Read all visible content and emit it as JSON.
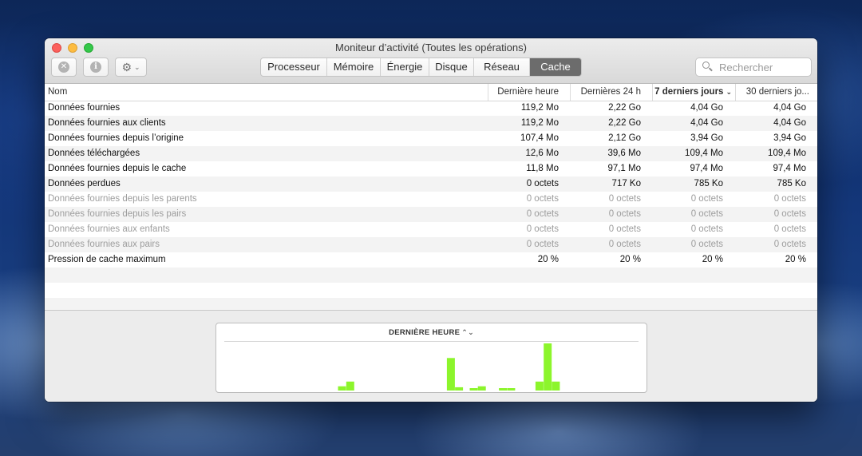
{
  "window": {
    "title": "Moniteur d’activité (Toutes les opérations)"
  },
  "toolbar": {
    "stop_icon": "x-circle-icon",
    "info_icon": "info-circle-icon",
    "gear_icon": "gear-icon"
  },
  "tabs": [
    {
      "label": "Processeur",
      "active": false
    },
    {
      "label": "Mémoire",
      "active": false
    },
    {
      "label": "Énergie",
      "active": false
    },
    {
      "label": "Disque",
      "active": false
    },
    {
      "label": "Réseau",
      "active": false
    },
    {
      "label": "Cache",
      "active": true
    }
  ],
  "search": {
    "placeholder": "Rechercher"
  },
  "table": {
    "columns": [
      "Nom",
      "Dernière heure",
      "Dernières 24 h",
      "7 derniers jours",
      "30 derniers jo..."
    ],
    "sorted_column": "7 derniers jours",
    "rows": [
      {
        "name": "Données fournies",
        "hour": "119,2 Mo",
        "day": "2,22 Go",
        "week": "4,04 Go",
        "month": "4,04 Go",
        "dim": false
      },
      {
        "name": "Données fournies aux clients",
        "hour": "119,2 Mo",
        "day": "2,22 Go",
        "week": "4,04 Go",
        "month": "4,04 Go",
        "dim": false
      },
      {
        "name": "Données fournies depuis l’origine",
        "hour": "107,4 Mo",
        "day": "2,12 Go",
        "week": "3,94 Go",
        "month": "3,94 Go",
        "dim": false
      },
      {
        "name": "Données téléchargées",
        "hour": "12,6 Mo",
        "day": "39,6 Mo",
        "week": "109,4 Mo",
        "month": "109,4 Mo",
        "dim": false
      },
      {
        "name": "Données fournies depuis le cache",
        "hour": "11,8 Mo",
        "day": "97,1 Mo",
        "week": "97,4 Mo",
        "month": "97,4 Mo",
        "dim": false
      },
      {
        "name": "Données perdues",
        "hour": "0 octets",
        "day": "717 Ko",
        "week": "785 Ko",
        "month": "785 Ko",
        "dim": false
      },
      {
        "name": "Données fournies depuis les parents",
        "hour": "0 octets",
        "day": "0 octets",
        "week": "0 octets",
        "month": "0 octets",
        "dim": true
      },
      {
        "name": "Données fournies depuis les pairs",
        "hour": "0 octets",
        "day": "0 octets",
        "week": "0 octets",
        "month": "0 octets",
        "dim": true
      },
      {
        "name": "Données fournies aux enfants",
        "hour": "0 octets",
        "day": "0 octets",
        "week": "0 octets",
        "month": "0 octets",
        "dim": true
      },
      {
        "name": "Données fournies aux pairs",
        "hour": "0 octets",
        "day": "0 octets",
        "week": "0 octets",
        "month": "0 octets",
        "dim": true
      },
      {
        "name": "Pression de cache maximum",
        "hour": "20 %",
        "day": "20 %",
        "week": "20 %",
        "month": "20 %",
        "dim": false
      }
    ],
    "empty_rows": 3
  },
  "graph": {
    "title": "DERNIÈRE HEURE",
    "bar_color": "#8cf52c",
    "bars": [
      {
        "slot": 0.283,
        "level": 0.09
      },
      {
        "slot": 0.302,
        "level": 0.19
      },
      {
        "slot": 0.536,
        "level": 0.69
      },
      {
        "slot": 0.555,
        "level": 0.07
      },
      {
        "slot": 0.589,
        "level": 0.05
      },
      {
        "slot": 0.608,
        "level": 0.09
      },
      {
        "slot": 0.657,
        "level": 0.05
      },
      {
        "slot": 0.676,
        "level": 0.05
      },
      {
        "slot": 0.742,
        "level": 0.19
      },
      {
        "slot": 0.761,
        "level": 1.0
      },
      {
        "slot": 0.78,
        "level": 0.19
      }
    ]
  }
}
